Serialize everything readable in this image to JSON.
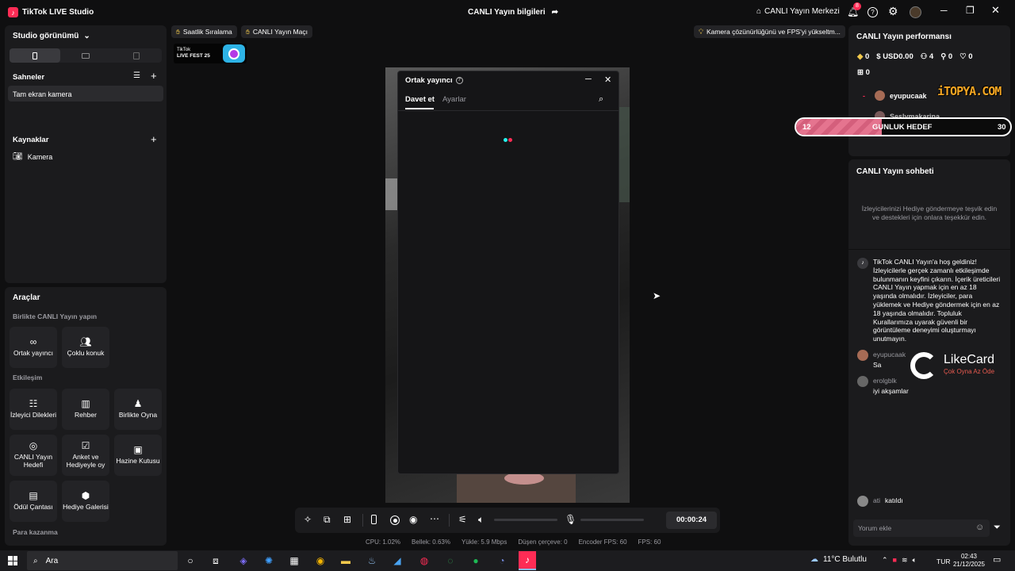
{
  "app": {
    "title": "TikTok LIVE Studio"
  },
  "header": {
    "center_title": "CANLI Yayın bilgileri",
    "live_center": "CANLI Yayın Merkezi",
    "notif_count": "8"
  },
  "left": {
    "studio_view": "Studio görünümü",
    "scenes_title": "Sahneler",
    "scene_item": "Tam ekran kamera",
    "sources_title": "Kaynaklar",
    "source_item": "Kamera",
    "tools_title": "Araçlar",
    "section_live_together": "Birlikte CANLI Yayın yapın",
    "cohost": "Ortak yayıncı",
    "multi_guest": "Çoklu konuk",
    "section_interaction": "Etkileşim",
    "viewer_requests": "İzleyici Dilekleri",
    "guide": "Rehber",
    "play_together": "Birlikte Oyna",
    "live_goal": "CANLI Yayın Hedefi",
    "poll": "Anket ve Hediyeyle oy",
    "treasure": "Hazine Kutusu",
    "reward_bag": "Ödül Çantası",
    "gift_gallery": "Hediye Galerisi",
    "section_earn": "Para kazanma"
  },
  "toolbar_chips": {
    "hourly_rank": "Saatlik Sıralama",
    "live_match": "CANLI Yayın Maçı",
    "camera_tip": "Kamera çözünürlüğünü ve FPS'yi yükseltm..."
  },
  "badge": {
    "line1": "TikTok",
    "line2": "LIVE FEST 25"
  },
  "dialog": {
    "title": "Ortak yayıncı",
    "tab_invite": "Davet et",
    "tab_settings": "Ayarlar"
  },
  "controls": {
    "timer": "00:00:24"
  },
  "stats": {
    "cpu": "CPU:  1.02%",
    "memory": "Bellek:  0.63%",
    "upload": "Yükle:  5.9 Mbps",
    "dropped": "Düşen çerçeve:  0",
    "encoder_fps": "Encoder FPS:  60",
    "fps": "FPS:  60"
  },
  "right": {
    "perf_title": "CANLI Yayın performansı",
    "diamonds": "0",
    "usd": "USD0.00",
    "viewers": "4",
    "follows": "0",
    "likes": "0",
    "gifts": "0",
    "user1": "eyupucaak",
    "user2": "Seslymakarina",
    "goal_left": "12",
    "goal_label": "GUNLUK HEDEF",
    "goal_right": "30",
    "overlay_text": "iTOPYA.COM",
    "chat_title": "CANLI Yayın sohbeti",
    "chat_hint": "İzleyicilerinizi Hediye göndermeye teşvik edin ve destekleri için onlara teşekkür edin.",
    "welcome": "TikTok CANLI Yayın'a hoş geldiniz! İzleyicilerle gerçek zamanlı etkileşimde bulunmanın keyfini çıkarın. İçerik üreticileri CANLI Yayın yapmak için en az 18 yaşında olmalıdır. İzleyiciler, para yüklemek ve Hediye göndermek için en az 18 yaşında olmalıdır. Topluluk Kurallarımıza uyarak güvenli bir görüntüleme deneyimi oluşturmayı unutmayın.",
    "msg1_user": "eyupucaak",
    "msg1_text": "Sa",
    "msg2_user": "erolgblk",
    "msg2_text": "iyi akşamlar",
    "join_user": "ati",
    "join_text": "katıldı",
    "comment_placeholder": "Yorum ekle",
    "likecard_title": "LikeCard",
    "likecard_sub": "Çok Oyna Az Öde"
  },
  "taskbar": {
    "search": "Ara",
    "weather": "11°C  Bulutlu",
    "lang": "TUR",
    "time": "02:43",
    "date": "21/12/2025"
  },
  "colors": {
    "accent": "#fe2c55",
    "cyan": "#25f4ee",
    "panel": "#1b1b1d",
    "goal_pink": "#e5748f"
  }
}
